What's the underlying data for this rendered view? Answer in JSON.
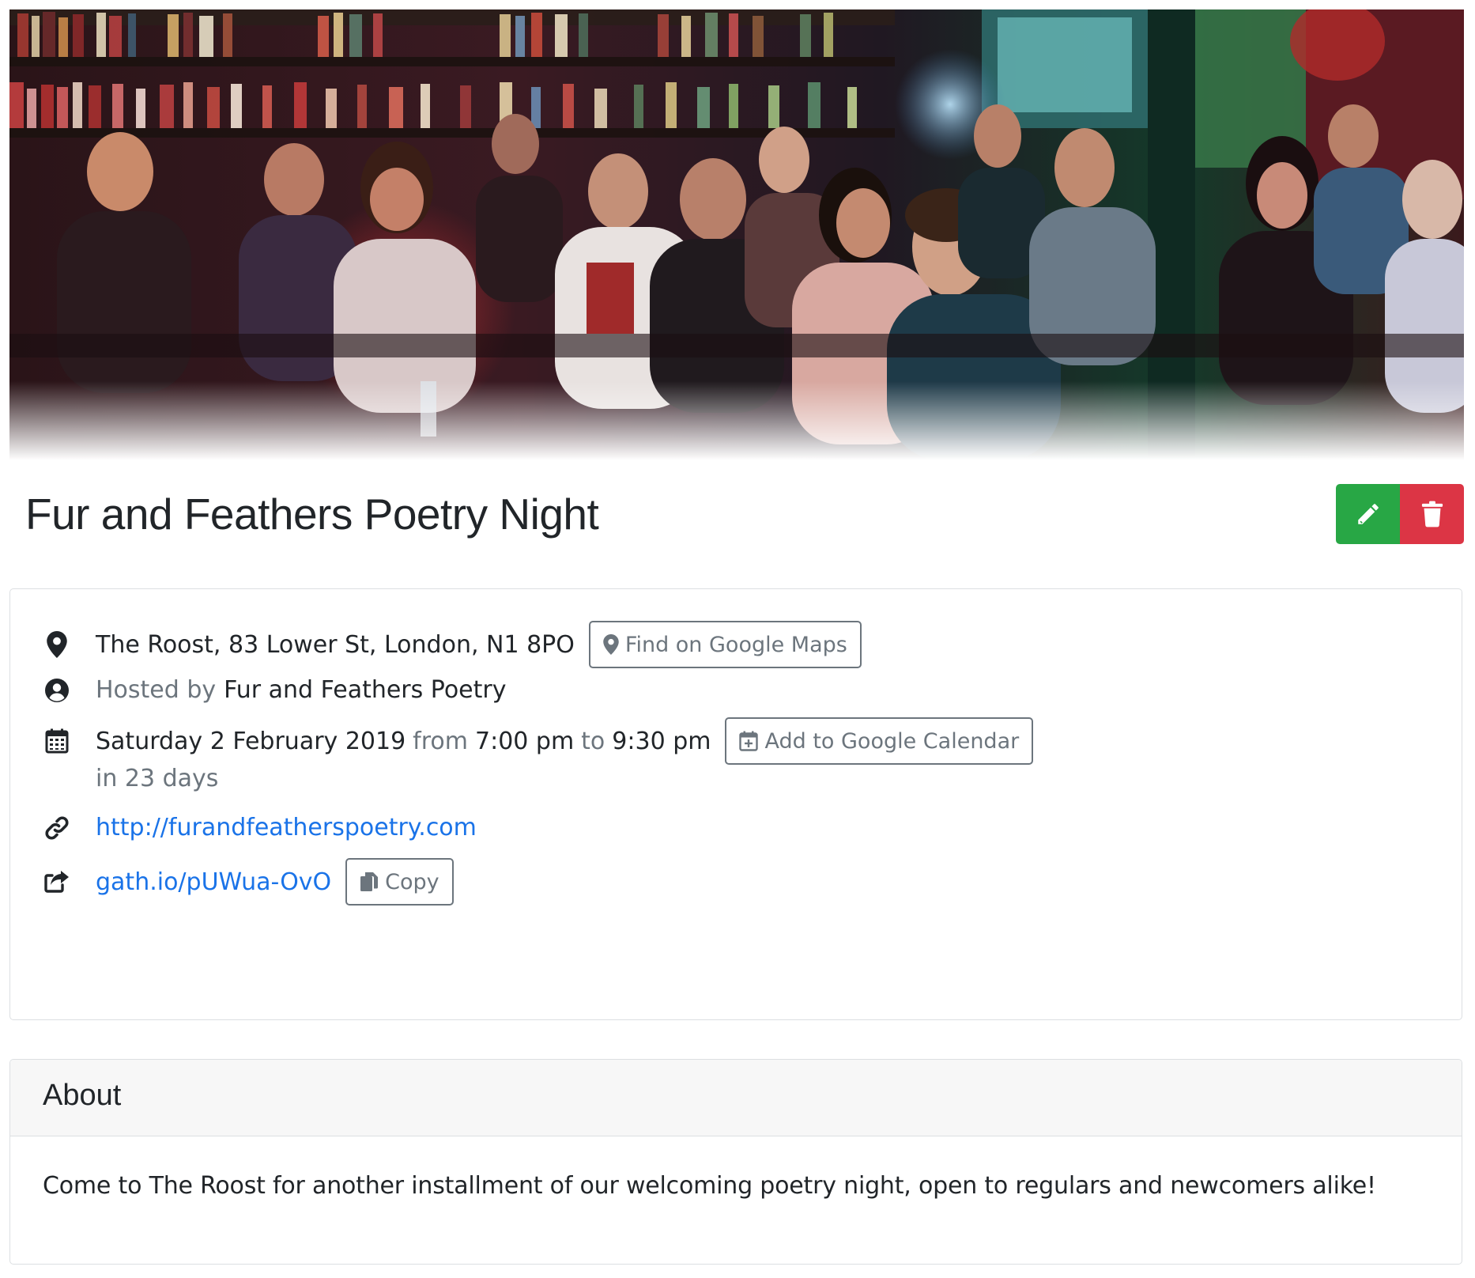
{
  "event": {
    "title": "Fur and Feathers Poetry Night"
  },
  "actions": {
    "edit_icon": "pencil-icon",
    "delete_icon": "trash-icon",
    "edit_color": "#28a745",
    "delete_color": "#dc3545"
  },
  "details": {
    "location": {
      "icon": "map-marker-icon",
      "address": "The Roost, 83 Lower St, London, N1 8PO",
      "maps_button_label": "Find on Google Maps"
    },
    "host": {
      "icon": "user-circle-icon",
      "prefix": "Hosted by",
      "name": "Fur and Feathers Poetry"
    },
    "date": {
      "icon": "calendar-icon",
      "day": "Saturday 2 February 2019",
      "from_word": "from",
      "start_time": "7:00 pm",
      "to_word": "to",
      "end_time": "9:30 pm",
      "calendar_button_label": "Add to Google Calendar",
      "relative": "in 23 days"
    },
    "website": {
      "icon": "link-icon",
      "url": "http://furandfeatherspoetry.com"
    },
    "share": {
      "icon": "share-icon",
      "short_link": "gath.io/pUWua-OvO",
      "copy_button_label": "Copy"
    }
  },
  "about": {
    "heading": "About",
    "body": "Come to The Roost for another installment of our welcoming poetry night, open to regulars and newcomers alike!"
  },
  "colors": {
    "link": "#1a73e8",
    "muted": "#6c757d",
    "text": "#212529"
  }
}
